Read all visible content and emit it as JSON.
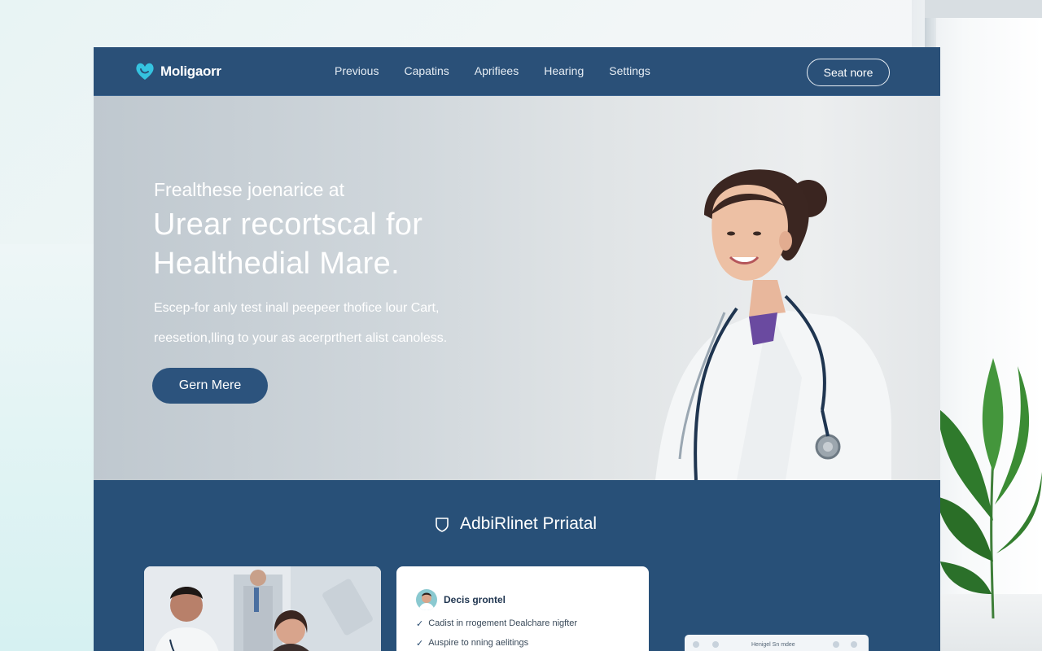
{
  "brand": {
    "name": "Moligaorr",
    "accent": "#35c3e0"
  },
  "nav": {
    "links": [
      "Previous",
      "Capatins",
      "Aprifiees",
      "Hearing",
      "Settings"
    ],
    "cta": "Seat nore"
  },
  "hero": {
    "eyebrow": "Frealthese joenarice at",
    "title_line1": "Urear recortscal for",
    "title_line2": "Healthedial Mare.",
    "body_line1": "Escep-for anly test inall peepeer thofice lour Cart,",
    "body_line2": "reesetion,lling to your as acerprthert alist canoless.",
    "button": "Gern Mere"
  },
  "section": {
    "icon": "shield-icon",
    "title": "AdbiRlinet Prriatal"
  },
  "info_card": {
    "title": "Decis grontel",
    "items": [
      "Cadist in rrogement Dealchare nigfter",
      "Auspire to nning aelitings"
    ]
  },
  "mini_card": {
    "text": "Henigel Sn mdee"
  },
  "colors": {
    "navy": "#2a5078",
    "button": "#2c537d",
    "white": "#ffffff"
  }
}
